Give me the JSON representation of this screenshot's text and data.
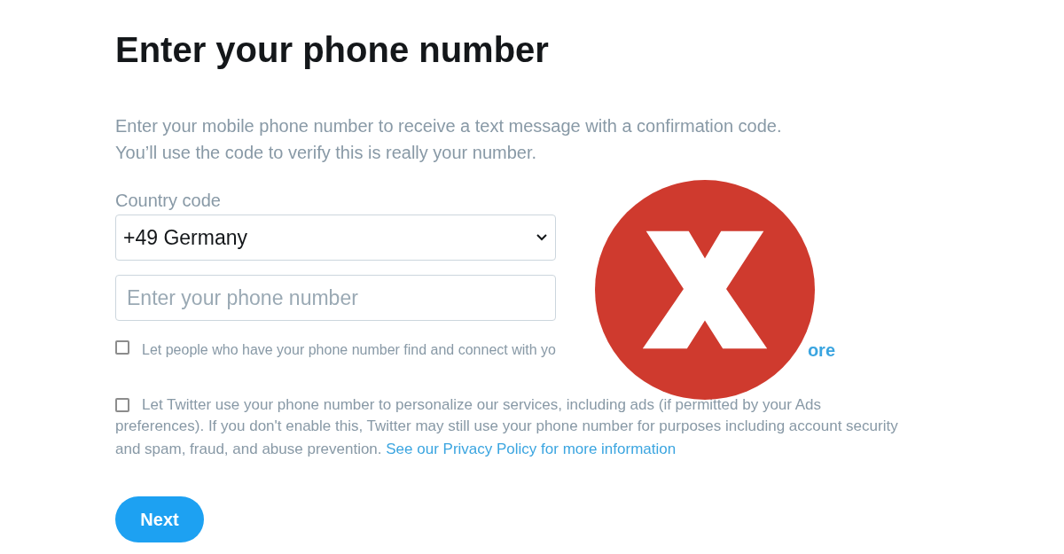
{
  "title": "Enter your phone number",
  "description": [
    "Enter your mobile phone number to receive a text message with a confirmation code.",
    "You’ll use the code to verify this is really your number."
  ],
  "country_field": {
    "label": "Country code",
    "value": "+49 Germany"
  },
  "phone_field": {
    "placeholder": "Enter your phone number"
  },
  "options": [
    {
      "checked": false,
      "text": "Let people who have your phone number find and connect with yo",
      "link": "ore"
    },
    {
      "checked": false,
      "text": "Let Twitter use your phone number to personalize our services, including ads (if permitted by your Ads",
      "continuation": "preferences). If you don't enable this, Twitter may still use your phone number for purposes including account security and spam, fraud, and abuse prevention.",
      "link": "See our Privacy Policy for more information"
    }
  ],
  "next_button": "Next",
  "overlay": {
    "kind": "cross"
  }
}
